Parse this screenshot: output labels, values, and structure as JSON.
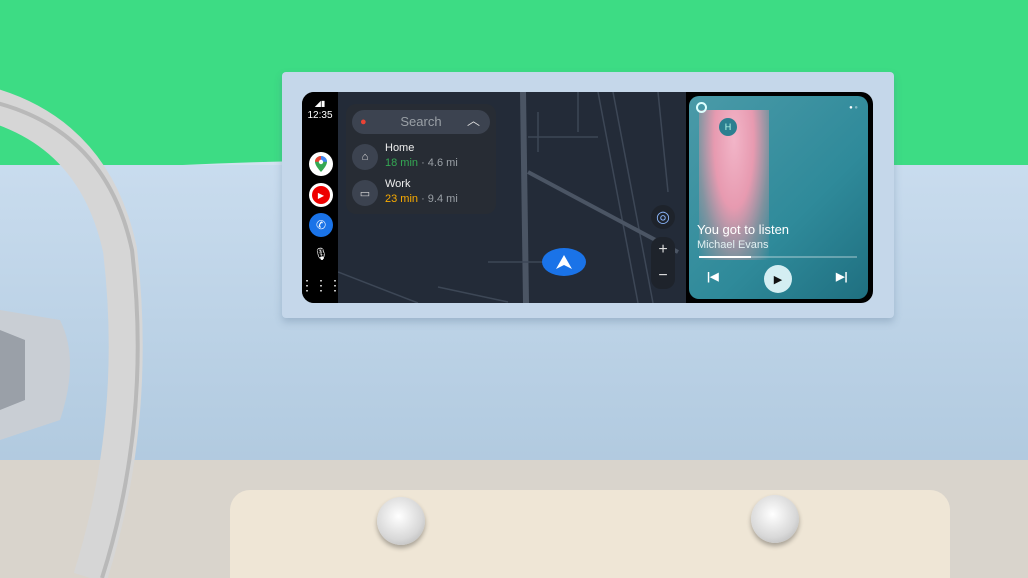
{
  "status": {
    "time": "12:35"
  },
  "rail": {
    "apps": [
      {
        "icon": "google-maps-icon"
      },
      {
        "icon": "youtube-music-icon"
      },
      {
        "icon": "phone-icon"
      }
    ],
    "mic_icon": "microphone-icon",
    "launcher_icon": "app-grid-icon"
  },
  "search": {
    "placeholder": "Search"
  },
  "destinations": [
    {
      "name": "Home",
      "time": "18 min",
      "distance": " · 4.6 mi",
      "time_color": "#34a853",
      "icon": "home-icon"
    },
    {
      "name": "Work",
      "time": "23 min",
      "distance": " · 9.4 mi",
      "time_color": "#f9ab00",
      "icon": "briefcase-icon"
    }
  ],
  "map_controls": {
    "recenter": "◎",
    "zoom_in": "+",
    "zoom_out": "−"
  },
  "media": {
    "title": "You got to listen",
    "artist": "Michael Evans",
    "progress": 0.33,
    "headphone_letter": "H"
  }
}
